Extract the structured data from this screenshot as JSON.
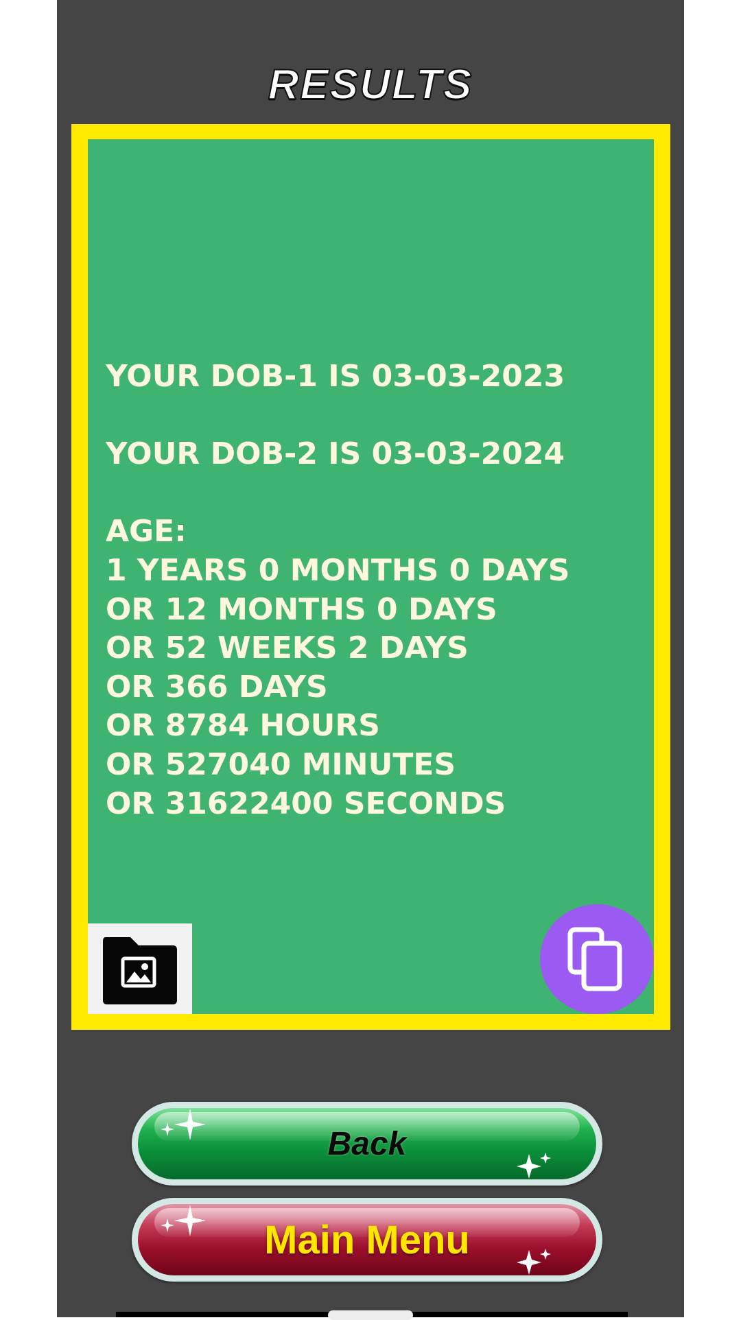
{
  "header": {
    "title": "RESULTS"
  },
  "result": {
    "lines": [
      "YOUR DOB-1 IS 03-03-2023",
      "",
      "YOUR DOB-2 IS 03-03-2024",
      "",
      "AGE:",
      "1 YEARS 0 MONTHS 0 DAYS",
      "OR 12 MONTHS 0 DAYS",
      "OR 52 WEEKS 2 DAYS",
      "OR 366 DAYS",
      "OR 8784 HOURS",
      "OR 527040 MINUTES",
      "OR 31622400 SECONDS"
    ]
  },
  "actions": {
    "save_image_icon": "folder-image-icon",
    "copy_icon": "copy-icon"
  },
  "buttons": {
    "back_label": "Back",
    "main_menu_label": "Main Menu"
  },
  "colors": {
    "screen_background": "#454545",
    "frame": "#FFEA00",
    "panel": "#3FB371",
    "result_text": "#FFF8DC",
    "copy_button": "#9B5BF2",
    "back_button": "#0B8E3A",
    "main_menu_button": "#9C0F2C",
    "main_menu_text": "#FFE600"
  }
}
